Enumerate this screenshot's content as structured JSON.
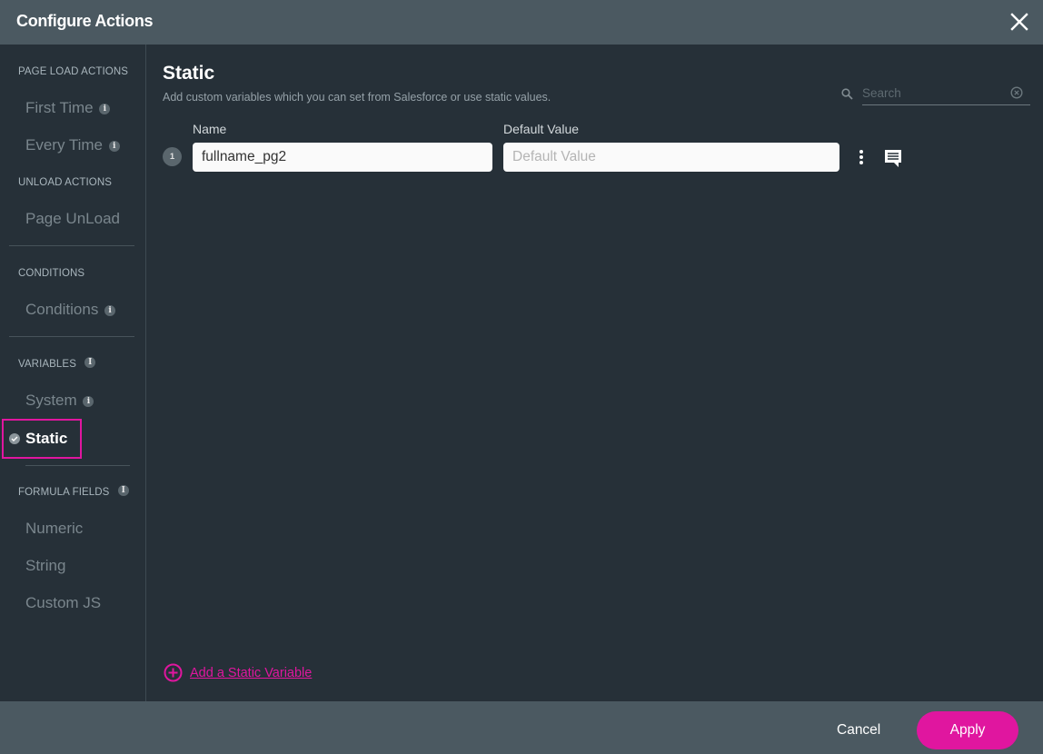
{
  "header": {
    "title": "Configure Actions",
    "close_icon": "close-icon"
  },
  "sidebar": {
    "sections": [
      {
        "label": "PAGE LOAD ACTIONS",
        "items": [
          {
            "label": "First Time",
            "info": "i"
          },
          {
            "label": "Every Time",
            "info": "i"
          }
        ]
      },
      {
        "label": "UNLOAD ACTIONS",
        "items": [
          {
            "label": "Page UnLoad"
          }
        ]
      },
      {
        "label": "CONDITIONS",
        "items": [
          {
            "label": "Conditions",
            "info": "i"
          }
        ]
      },
      {
        "label": "VARIABLES",
        "info": "i",
        "items": [
          {
            "label": "System",
            "info": "i"
          },
          {
            "label": "Static",
            "active": true
          }
        ]
      },
      {
        "label": "FORMULA FIELDS",
        "info": "i",
        "items": [
          {
            "label": "Numeric"
          },
          {
            "label": "String"
          },
          {
            "label": "Custom JS"
          }
        ]
      }
    ]
  },
  "main": {
    "title": "Static",
    "subtitle": "Add custom variables which you can set from Salesforce or use static values.",
    "search": {
      "placeholder": "Search",
      "value": ""
    },
    "columns": {
      "name": "Name",
      "default_value": "Default Value"
    },
    "rows": [
      {
        "index": "1",
        "name": "fullname_pg2",
        "default_value": "",
        "default_placeholder": "Default Value"
      }
    ],
    "add_label": "Add a Static Variable"
  },
  "footer": {
    "cancel_label": "Cancel",
    "apply_label": "Apply"
  },
  "colors": {
    "accent": "#e0169f",
    "header_bg": "#4b5961",
    "body_bg": "#263038"
  }
}
